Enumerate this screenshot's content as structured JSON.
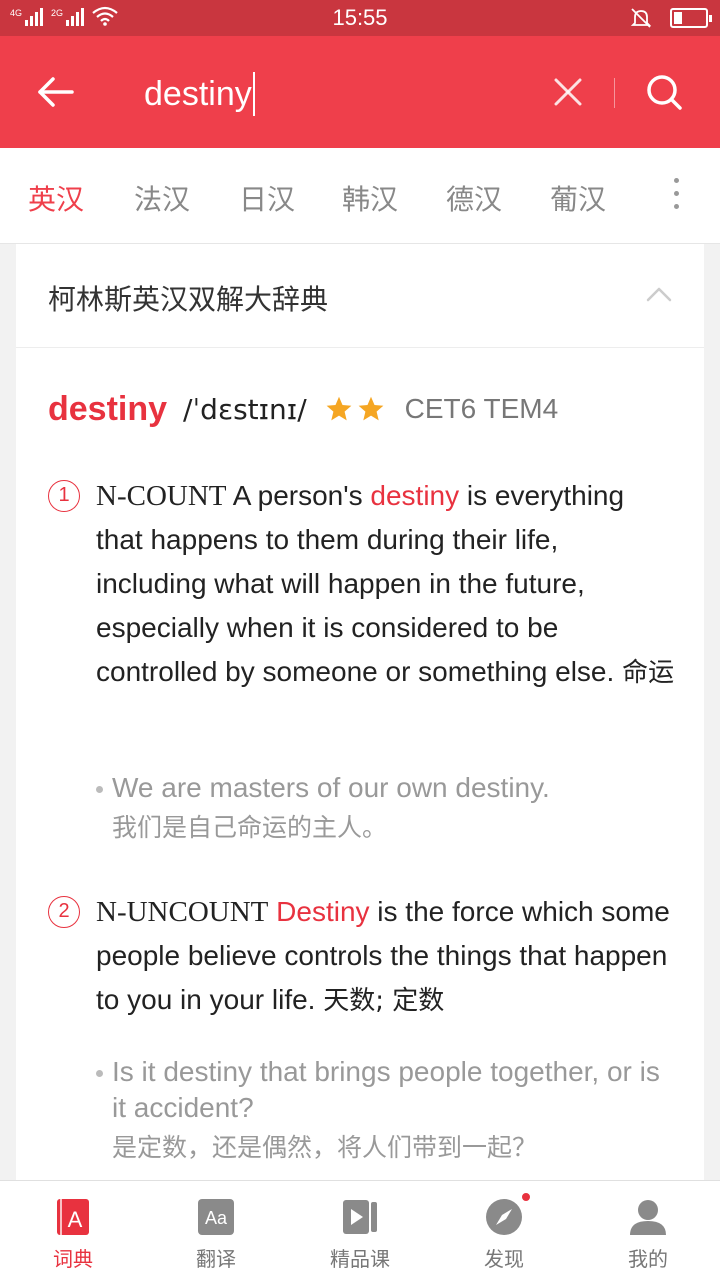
{
  "status_bar": {
    "time": "15:55",
    "signal1_label": "4G",
    "signal2_label": "2G"
  },
  "search": {
    "query": "destiny"
  },
  "language_tabs": [
    "英汉",
    "法汉",
    "日汉",
    "韩汉",
    "德汉",
    "葡汉"
  ],
  "dictionary": {
    "title": "柯林斯英汉双解大辞典",
    "headword": "destiny",
    "phonetic": "/ˈdɛstɪnɪ/",
    "star_count": 2,
    "levels": "CET6 TEM4",
    "senses": [
      {
        "num": "1",
        "pos": "N-COUNT",
        "def_pre": " A person's ",
        "def_hl": "destiny",
        "def_post": " is everything that happens to them during their life, including what will happen in the future, especially when it is considered to be controlled by someone or something else. ",
        "def_cn": "命运",
        "example_en": "We are masters of our own destiny.",
        "example_cn": "我们是自己命运的主人。"
      },
      {
        "num": "2",
        "pos": "N-UNCOUNT",
        "def_pre": " ",
        "def_hl": "Destiny",
        "def_post": " is the force which some people believe controls the things that happen to you in your life. ",
        "def_cn": "天数; 定数",
        "example_en": "Is it destiny that brings people together, or is it accident?",
        "example_cn": "是定数，还是偶然，将人们带到一起？"
      }
    ]
  },
  "bottom_nav": [
    {
      "label": "词典",
      "icon": "dictionary-icon"
    },
    {
      "label": "翻译",
      "icon": "translate-icon"
    },
    {
      "label": "精品课",
      "icon": "course-icon"
    },
    {
      "label": "发现",
      "icon": "compass-icon"
    },
    {
      "label": "我的",
      "icon": "profile-icon"
    }
  ],
  "colors": {
    "brand_red": "#ef3f4b",
    "status_bar": "#c9363f",
    "highlight": "#e8323f",
    "star": "#f5a623"
  }
}
